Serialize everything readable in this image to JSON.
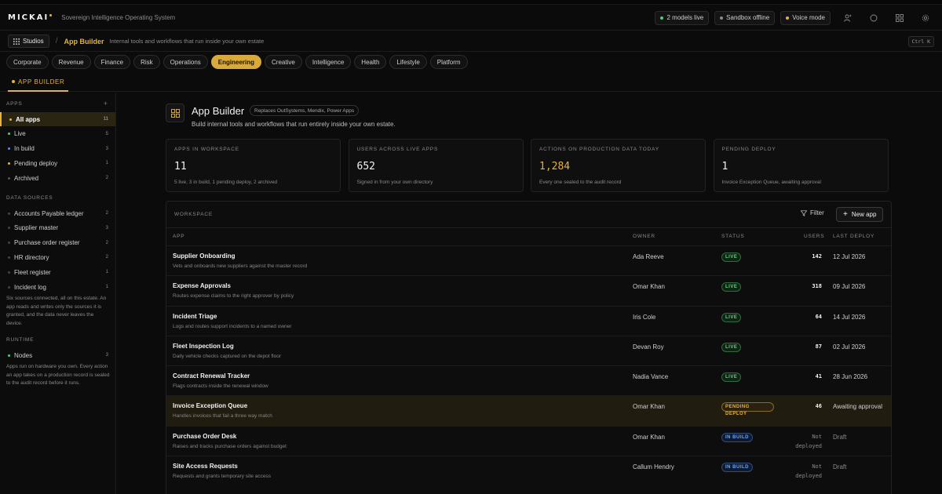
{
  "brand": {
    "logo": "MICKAI",
    "tagline": "Sovereign Intelligence Operating System"
  },
  "top_status": [
    {
      "label": "2 models live",
      "color": "#4cd07a"
    },
    {
      "label": "Sandbox offline",
      "color": "#8a8a8a"
    },
    {
      "label": "Voice mode",
      "color": "#e4b43c"
    }
  ],
  "top_icons": [
    "people-icon",
    "circle-icon",
    "grid-icon",
    "gear-icon"
  ],
  "crumb": {
    "studios": "Studios",
    "title": "App Builder",
    "subtitle": "Internal tools and workflows that run inside your own estate",
    "shortcut": "Ctrl K"
  },
  "categories": [
    {
      "label": "Corporate"
    },
    {
      "label": "Revenue"
    },
    {
      "label": "Finance"
    },
    {
      "label": "Risk"
    },
    {
      "label": "Operations"
    },
    {
      "label": "Engineering",
      "active": true
    },
    {
      "label": "Creative"
    },
    {
      "label": "Intelligence"
    },
    {
      "label": "Health"
    },
    {
      "label": "Lifestyle"
    },
    {
      "label": "Platform"
    }
  ],
  "tab": {
    "label": "APP BUILDER"
  },
  "sidebar": {
    "apps_head": "APPS",
    "apps": [
      {
        "label": "All apps",
        "count": "11",
        "color": "#e4b43c",
        "active": true
      },
      {
        "label": "Live",
        "count": "5",
        "color": "#4cd07a"
      },
      {
        "label": "In build",
        "count": "3",
        "color": "#5b8def"
      },
      {
        "label": "Pending deploy",
        "count": "1",
        "color": "#e4b43c"
      },
      {
        "label": "Archived",
        "count": "2",
        "color": "#555555"
      }
    ],
    "sources_head": "DATA SOURCES",
    "sources": [
      {
        "label": "Accounts Payable ledger",
        "count": "2"
      },
      {
        "label": "Supplier master",
        "count": "3"
      },
      {
        "label": "Purchase order register",
        "count": "2"
      },
      {
        "label": "HR directory",
        "count": "2"
      },
      {
        "label": "Fleet register",
        "count": "1"
      },
      {
        "label": "Incident log",
        "count": "1"
      }
    ],
    "sources_note": "Six sources connected, all on this estate. An app reads and writes only the sources it is granted, and the data never leaves the device.",
    "runtime_head": "RUNTIME",
    "runtime": [
      {
        "label": "Nodes",
        "count": "3",
        "color": "#4cd07a"
      }
    ],
    "runtime_note": "Apps run on hardware you own. Every action an app takes on a production record is sealed to the audit record before it runs."
  },
  "hero": {
    "title": "App Builder",
    "badge": "Replaces OutSystems, Mendix, Power Apps",
    "subtitle": "Build internal tools and workflows that run entirely inside your own estate."
  },
  "stats": [
    {
      "label": "APPS IN WORKSPACE",
      "value": "11",
      "note": "5 live, 3 in build, 1 pending deploy, 2 archived"
    },
    {
      "label": "USERS ACROSS LIVE APPS",
      "value": "652",
      "note": "Signed in from your own directory"
    },
    {
      "label": "ACTIONS ON PRODUCTION DATA TODAY",
      "value": "1,284",
      "note": "Every one sealed to the audit record",
      "amber": true
    },
    {
      "label": "PENDING DEPLOY",
      "value": "1",
      "note": "Invoice Exception Queue, awaiting approval"
    }
  ],
  "workspace": {
    "title": "WORKSPACE",
    "filter": "Filter",
    "new_app": "New app",
    "columns": {
      "app": "APP",
      "owner": "OWNER",
      "status": "STATUS",
      "users": "USERS",
      "deploy": "LAST DEPLOY"
    },
    "rows": [
      {
        "name": "Supplier Onboarding",
        "desc": "Vets and onboards new suppliers against the master record",
        "owner": "Ada Reeve",
        "status": "LIVE",
        "kind": "live",
        "users": "142",
        "deploy": "12 Jul 2026"
      },
      {
        "name": "Expense Approvals",
        "desc": "Routes expense claims to the right approver by policy",
        "owner": "Omar Khan",
        "status": "LIVE",
        "kind": "live",
        "users": "318",
        "deploy": "09 Jul 2026"
      },
      {
        "name": "Incident Triage",
        "desc": "Logs and routes support incidents to a named owner",
        "owner": "Iris Cole",
        "status": "LIVE",
        "kind": "live",
        "users": "64",
        "deploy": "14 Jul 2026"
      },
      {
        "name": "Fleet Inspection Log",
        "desc": "Daily vehicle checks captured on the depot floor",
        "owner": "Devan Roy",
        "status": "LIVE",
        "kind": "live",
        "users": "87",
        "deploy": "02 Jul 2026"
      },
      {
        "name": "Contract Renewal Tracker",
        "desc": "Flags contracts inside the renewal window",
        "owner": "Nadia Vance",
        "status": "LIVE",
        "kind": "live",
        "users": "41",
        "deploy": "28 Jun 2026"
      },
      {
        "name": "Invoice Exception Queue",
        "desc": "Handles invoices that fail a three way match",
        "owner": "Omar Khan",
        "status": "PENDING DEPLOY",
        "kind": "pending",
        "users": "46",
        "deploy": "Awaiting approval",
        "highlight": true
      },
      {
        "name": "Purchase Order Desk",
        "desc": "Raises and tracks purchase orders against budget",
        "owner": "Omar Khan",
        "status": "IN BUILD",
        "kind": "build",
        "users": "Not deployed",
        "deploy": "Draft",
        "muted": true
      },
      {
        "name": "Site Access Requests",
        "desc": "Requests and grants temporary site access",
        "owner": "Callum Hendry",
        "status": "IN BUILD",
        "kind": "build",
        "users": "Not deployed",
        "deploy": "Draft",
        "muted": true
      }
    ]
  }
}
